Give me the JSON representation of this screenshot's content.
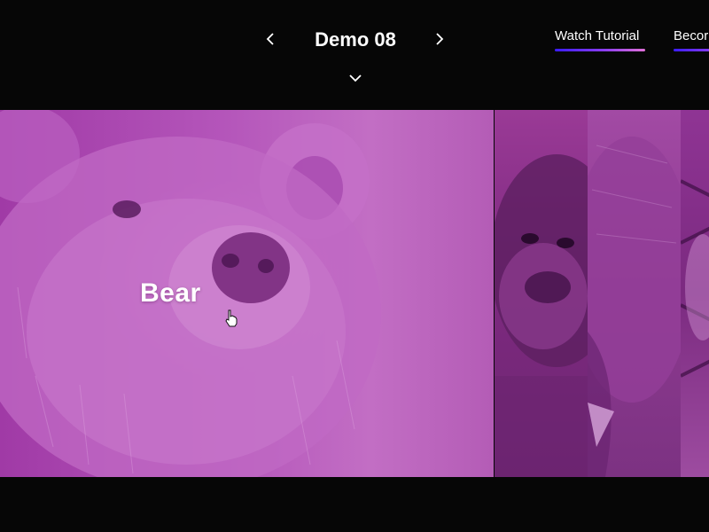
{
  "header": {
    "title": "Demo 08",
    "links": {
      "tutorial": "Watch Tutorial",
      "become": "Becor"
    }
  },
  "icons": {
    "prev": "chevron-left-icon",
    "next": "chevron-right-icon",
    "expand": "chevron-down-icon",
    "cursor": "hand-pointer-icon"
  },
  "gallery": {
    "active_label": "Bear",
    "panels": [
      "bear",
      "gorilla",
      "elephant",
      "tiger"
    ]
  },
  "colors": {
    "background": "#060606",
    "overlay": "#b455ba",
    "underline_start": "#3b1cff",
    "underline_end": "#e070d8"
  }
}
